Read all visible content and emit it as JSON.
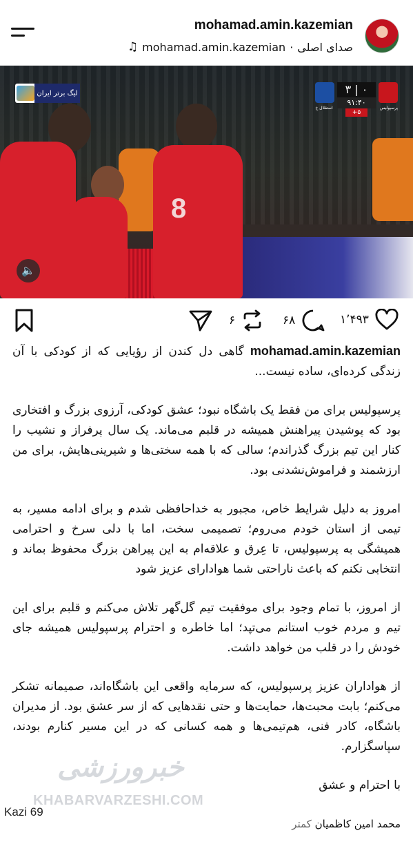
{
  "header": {
    "username": "mohamad.amin.kazemian",
    "audio_label": "صدای اصلی",
    "audio_separator": "·",
    "audio_username": "mohamad.amin.kazemian"
  },
  "video": {
    "league_label": "لیگ برتر ایران",
    "score": "۳ | ۰",
    "clock": "۹۱:۴۰",
    "extra_time": "+۵",
    "home_team": "پرسپولیس",
    "away_team": "استقلال خ",
    "jersey_number": "8"
  },
  "actions": {
    "likes": "۱٬۴۹۳",
    "comments": "۶۸",
    "reposts": "۶"
  },
  "caption": {
    "username": "mohamad.amin.kazemian",
    "intro": "گاهی دل کندن از رؤیایی که از کودکی با آن زندگی کرده‌ای، ساده نیست...",
    "p1": "پرسپولیس برای من فقط یک باشگاه نبود؛ عشق کودکی، آرزوی بزرگ و افتخاری بود که پوشیدن پیراهنش همیشه در قلبم می‌ماند. یک سال پرفراز و نشیب را کنار این تیم بزرگ گذراندم؛ سالی که با همه سختی‌ها و شیرینی‌هایش، برای من ارزشمند و فراموش‌نشدنی بود.",
    "p2": "امروز به دلیل شرایط خاص، مجبور به خداحافظی شدم و برای ادامه مسیر، به تیمی از استان خودم می‌روم؛ تصمیمی سخت، اما با دلی سرخ و احترامی همیشگی به پرسپولیس، تا عِرق و علاقه‌ام به این پیراهن بزرگ محفوظ بماند و انتخابی نکنم که باعث ناراحتی  شما هوادارای عزیز  شود",
    "p3": "از امروز، با تمام وجود برای موفقیت تیم گل‌گهر تلاش می‌کنم و قلبم برای این تیم و مردم خوب استانم می‌تپد؛ اما خاطره و احترام پرسپولیس همیشه جای خودش را در قلب من خواهد داشت.",
    "p4": "از هواداران عزیز پرسپولیس، که سرمایه واقعی این باشگاه‌اند، صمیمانه تشکر می‌کنم؛ بابت محبت‌ها، حمایت‌ها و حتی نقدهایی که از سر عشق بود. از مدیران باشگاه، کادر فنی، هم‌تیمی‌ها و همه کسانی که در این مسیر کنارم بودند، سپاسگزارم.",
    "signoff": "با احترام و عشق",
    "signature": "محمد امین کاظمیان"
  },
  "watermark": {
    "logo_text": "خبرورزشی",
    "url": "KHABARVARZESHI.COM"
  },
  "overlay": {
    "kazi_label": "Kazi 69",
    "less_label": "کمتر"
  }
}
